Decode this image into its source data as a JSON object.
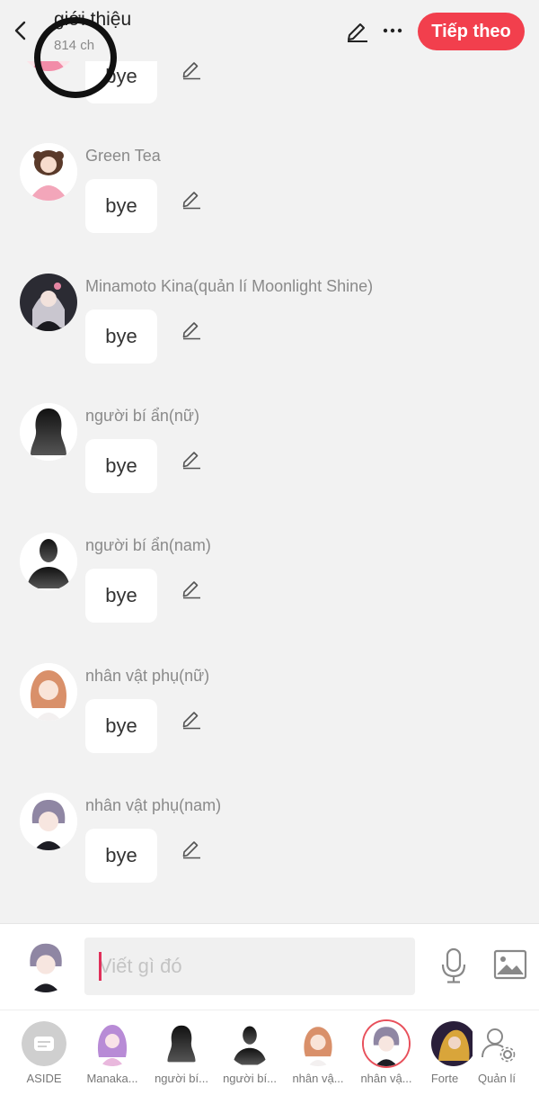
{
  "header": {
    "title": "giới thiệu",
    "subtitle": "814 ch",
    "next_label": "Tiếp theo"
  },
  "messages": [
    {
      "name": "",
      "text": "bye",
      "avatar": "pink-girl-avatar"
    },
    {
      "name": "Green Tea",
      "text": "bye",
      "avatar": "green-tea-avatar"
    },
    {
      "name": "Minamoto Kina(quản lí Moonlight Shine)",
      "text": "bye",
      "avatar": "minamoto-kina-avatar"
    },
    {
      "name": "người bí ẩn(nữ)",
      "text": "bye",
      "avatar": "silhouette-female-avatar"
    },
    {
      "name": "người bí ẩn(nam)",
      "text": "bye",
      "avatar": "silhouette-male-avatar"
    },
    {
      "name": "nhân vật phụ(nữ)",
      "text": "bye",
      "avatar": "side-female-avatar"
    },
    {
      "name": "nhân vật phụ(nam)",
      "text": "bye",
      "avatar": "side-male-avatar"
    }
  ],
  "input": {
    "placeholder": "Viết gì đó"
  },
  "characters": [
    {
      "label": "ASIDE"
    },
    {
      "label": "Manaka..."
    },
    {
      "label": "người bí..."
    },
    {
      "label": "người bí..."
    },
    {
      "label": "nhân vậ..."
    },
    {
      "label": "nhân vậ..."
    },
    {
      "label": "Forte"
    },
    {
      "label": "Quản lí"
    }
  ],
  "colors": {
    "accent": "#f23f4d",
    "background": "#f2f2f2",
    "caret": "#e0305a"
  }
}
